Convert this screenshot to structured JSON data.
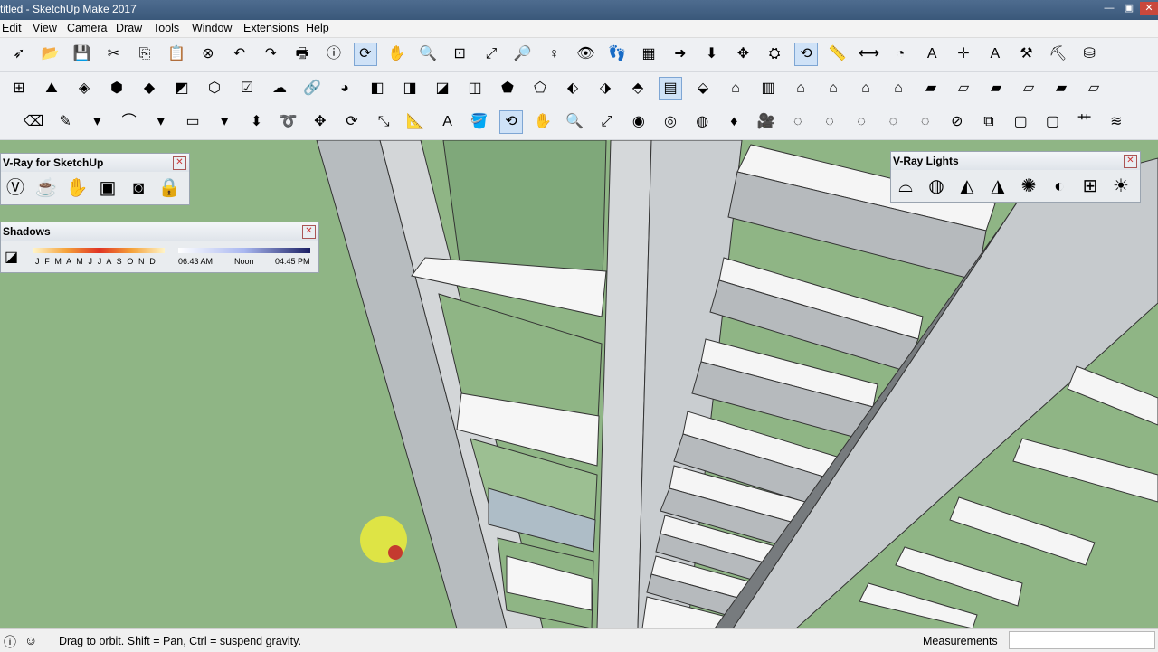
{
  "window": {
    "title": "titled - SketchUp Make 2017",
    "buttons": [
      "—",
      "▣",
      "✕"
    ]
  },
  "menu": {
    "items": [
      "Edit",
      "View",
      "Camera",
      "Draw",
      "Tools",
      "Window",
      "Extensions",
      "Help"
    ]
  },
  "toolbars": {
    "row1": [
      {
        "name": "select-icon",
        "glyph": "➶"
      },
      {
        "name": "open-folder-icon",
        "glyph": "📂"
      },
      {
        "name": "save-icon",
        "glyph": "💾"
      },
      {
        "name": "cut-icon",
        "glyph": "✂"
      },
      {
        "name": "copy-icon",
        "glyph": "⎘"
      },
      {
        "name": "paste-icon",
        "glyph": "📋"
      },
      {
        "name": "erase-icon",
        "glyph": "⊗"
      },
      {
        "name": "undo-icon",
        "glyph": "↶"
      },
      {
        "name": "redo-icon",
        "glyph": "↷"
      },
      {
        "name": "print-icon",
        "glyph": "🖶"
      },
      {
        "name": "model-info-icon",
        "glyph": "ⓘ"
      },
      {
        "name": "orbit-icon",
        "glyph": "⟳",
        "active": true
      },
      {
        "name": "pan-icon",
        "glyph": "✋"
      },
      {
        "name": "zoom-icon",
        "glyph": "🔍"
      },
      {
        "name": "zoom-window-icon",
        "glyph": "⊡"
      },
      {
        "name": "zoom-extents-icon",
        "glyph": "⤢"
      },
      {
        "name": "previous-view-icon",
        "glyph": "🔎"
      },
      {
        "name": "position-camera-icon",
        "glyph": "♀"
      },
      {
        "name": "look-around-icon",
        "glyph": "👁"
      },
      {
        "name": "walk-icon",
        "glyph": "👣"
      },
      {
        "name": "warehouse-icon",
        "glyph": "▦"
      },
      {
        "name": "share-model-icon",
        "glyph": "➜"
      },
      {
        "name": "download-icon",
        "glyph": "⬇"
      },
      {
        "name": "move-axes-icon",
        "glyph": "✥"
      },
      {
        "name": "walk-mode-icon",
        "glyph": "⛭"
      },
      {
        "name": "orbit-mode-icon",
        "glyph": "⟲",
        "active": true
      },
      {
        "name": "tape-measure-icon",
        "glyph": "📏"
      },
      {
        "name": "dimension-icon",
        "glyph": "⟷"
      },
      {
        "name": "protractor-icon",
        "glyph": "◔"
      },
      {
        "name": "text-icon",
        "glyph": "A"
      },
      {
        "name": "axes-icon",
        "glyph": "✛"
      },
      {
        "name": "3d-text-icon",
        "glyph": "A"
      },
      {
        "name": "extension-a-icon",
        "glyph": "⚒"
      },
      {
        "name": "extension-b-icon",
        "glyph": "⛏"
      },
      {
        "name": "extension-c-icon",
        "glyph": "⛁"
      }
    ],
    "row2": [
      {
        "name": "grid-icon",
        "glyph": "⊞"
      },
      {
        "name": "terrain-icon",
        "glyph": "⛰"
      },
      {
        "name": "sandbox-icon",
        "glyph": "◈"
      },
      {
        "name": "drape-icon",
        "glyph": "⬢"
      },
      {
        "name": "stamp-icon",
        "glyph": "◆"
      },
      {
        "name": "flip-edge-icon",
        "glyph": "◩"
      },
      {
        "name": "component-icon",
        "glyph": "⬡"
      },
      {
        "name": "check-icon",
        "glyph": "☑"
      },
      {
        "name": "cloud-upload-icon",
        "glyph": "☁"
      },
      {
        "name": "link-icon",
        "glyph": "🔗"
      },
      {
        "name": "color-cube-icon",
        "glyph": "◕"
      },
      {
        "name": "material-a-icon",
        "glyph": "◧"
      },
      {
        "name": "material-b-icon",
        "glyph": "◨"
      },
      {
        "name": "material-c-icon",
        "glyph": "◪"
      },
      {
        "name": "material-d-icon",
        "glyph": "◫"
      },
      {
        "name": "xray-icon",
        "glyph": "⬟"
      },
      {
        "name": "back-edges-icon",
        "glyph": "⬠"
      },
      {
        "name": "wireframe-icon",
        "glyph": "⬖"
      },
      {
        "name": "hidden-line-icon",
        "glyph": "⬗"
      },
      {
        "name": "shaded-icon",
        "glyph": "⬘"
      },
      {
        "name": "shaded-textures-icon",
        "glyph": "▤",
        "active": true
      },
      {
        "name": "monochrome-icon",
        "glyph": "⬙"
      },
      {
        "name": "iso-view-icon",
        "glyph": "⌂"
      },
      {
        "name": "top-view-icon",
        "glyph": "▥"
      },
      {
        "name": "front-view-icon",
        "glyph": "⌂"
      },
      {
        "name": "right-view-icon",
        "glyph": "⌂"
      },
      {
        "name": "back-view-icon",
        "glyph": "⌂"
      },
      {
        "name": "left-view-icon",
        "glyph": "⌂"
      },
      {
        "name": "section-a-icon",
        "glyph": "▰"
      },
      {
        "name": "section-b-icon",
        "glyph": "▱"
      },
      {
        "name": "section-c-icon",
        "glyph": "▰"
      },
      {
        "name": "section-d-icon",
        "glyph": "▱"
      },
      {
        "name": "section-e-icon",
        "glyph": "▰"
      },
      {
        "name": "section-f-icon",
        "glyph": "▱"
      }
    ],
    "row3": [
      {
        "name": "eraser-icon",
        "glyph": "⌫"
      },
      {
        "name": "pencil-icon",
        "glyph": "✎"
      },
      {
        "name": "dropdown-arrow-icon",
        "glyph": "▾"
      },
      {
        "name": "arc-icon",
        "glyph": "⌒"
      },
      {
        "name": "dropdown-arrow-icon",
        "glyph": "▾"
      },
      {
        "name": "rectangle-icon",
        "glyph": "▭"
      },
      {
        "name": "dropdown-arrow-icon",
        "glyph": "▾"
      },
      {
        "name": "push-pull-icon",
        "glyph": "⬍"
      },
      {
        "name": "follow-me-icon",
        "glyph": "➰"
      },
      {
        "name": "move-icon",
        "glyph": "✥"
      },
      {
        "name": "rotate-icon",
        "glyph": "⟳"
      },
      {
        "name": "scale-icon",
        "glyph": "⤡"
      },
      {
        "name": "tape-icon",
        "glyph": "📐"
      },
      {
        "name": "text-label-icon",
        "glyph": "A"
      },
      {
        "name": "paint-bucket-icon",
        "glyph": "🪣"
      },
      {
        "name": "orbit-tool-icon",
        "glyph": "⟲",
        "active": true
      },
      {
        "name": "pan-tool-icon",
        "glyph": "✋"
      },
      {
        "name": "zoom-tool-icon",
        "glyph": "🔍"
      },
      {
        "name": "zoom-extents-tool-icon",
        "glyph": "⤢"
      },
      {
        "name": "render-a-icon",
        "glyph": "◉"
      },
      {
        "name": "render-b-icon",
        "glyph": "◎"
      },
      {
        "name": "render-c-icon",
        "glyph": "◍"
      },
      {
        "name": "ruby-icon",
        "glyph": "♦"
      },
      {
        "name": "camera-a-icon",
        "glyph": "🎥"
      },
      {
        "name": "camera-b-icon",
        "glyph": "◌"
      },
      {
        "name": "camera-c-icon",
        "glyph": "◌"
      },
      {
        "name": "camera-d-icon",
        "glyph": "◌"
      },
      {
        "name": "camera-e-icon",
        "glyph": "◌"
      },
      {
        "name": "camera-f-icon",
        "glyph": "◌"
      },
      {
        "name": "no-entry-icon",
        "glyph": "⊘"
      },
      {
        "name": "layers-icon",
        "glyph": "⧉"
      },
      {
        "name": "box-a-icon",
        "glyph": "▢"
      },
      {
        "name": "box-b-icon",
        "glyph": "▢"
      },
      {
        "name": "grass-icon",
        "glyph": "⺾"
      },
      {
        "name": "fur-icon",
        "glyph": "≋"
      }
    ]
  },
  "vray_panel": {
    "title": "V-Ray for SketchUp",
    "icons": [
      "vray-logo-icon",
      "teapot-icon",
      "render-hand-icon",
      "frame-buffer-icon",
      "interactive-render-icon",
      "lock-icon"
    ]
  },
  "shadows_panel": {
    "title": "Shadows",
    "months": "J F M A M J J A S O N D",
    "time_start": "06:43 AM",
    "time_mid": "Noon",
    "time_end": "04:45 PM"
  },
  "vray_lights_panel": {
    "title": "V-Ray Lights",
    "icons": [
      "dome-light-icon",
      "sphere-light-icon",
      "spot-light-icon",
      "ies-light-icon",
      "omni-light-icon",
      "mesh-light-icon",
      "rect-light-icon",
      "sun-light-icon"
    ]
  },
  "status": {
    "text": "Drag to orbit. Shift = Pan, Ctrl = suspend gravity.",
    "measurements_label": "Measurements",
    "measurements_value": ""
  }
}
